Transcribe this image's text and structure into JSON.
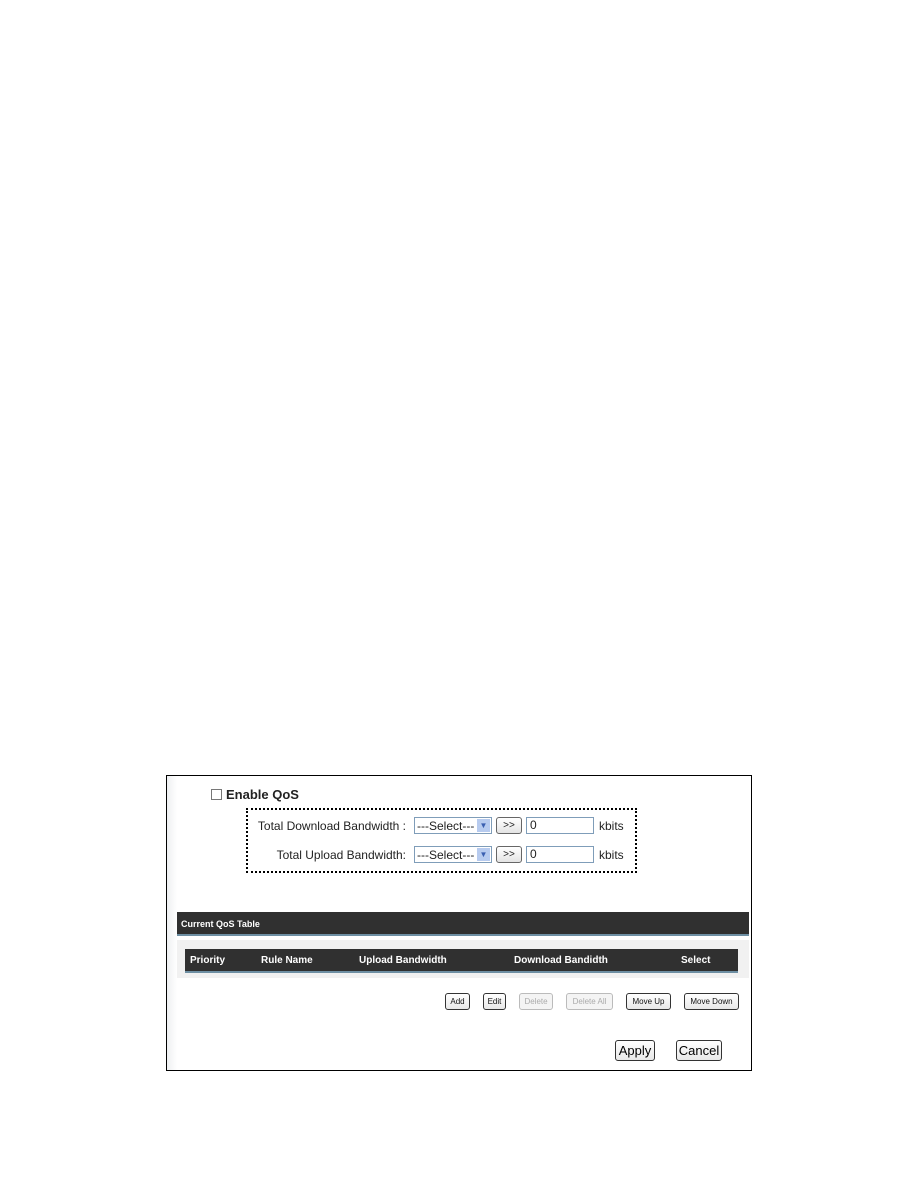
{
  "enable_qos": {
    "label": "Enable QoS",
    "checked": false
  },
  "bandwidth": [
    {
      "label": "Total Download Bandwidth :",
      "select": "---Select---",
      "go": ">>",
      "value": "0",
      "unit": "kbits"
    },
    {
      "label": "Total Upload Bandwidth:",
      "select": "---Select---",
      "go": ">>",
      "value": "0",
      "unit": "kbits"
    }
  ],
  "table": {
    "title": "Current QoS Table",
    "columns": [
      "Priority",
      "Rule Name",
      "Upload Bandwidth",
      "Download Bandidth",
      "Select"
    ],
    "rows": []
  },
  "actions": {
    "add": "Add",
    "edit": "Edit",
    "delete": "Delete",
    "delete_all": "Delete All",
    "move_up": "Move Up",
    "move_down": "Move Down"
  },
  "footer": {
    "apply": "Apply",
    "cancel": "Cancel"
  }
}
